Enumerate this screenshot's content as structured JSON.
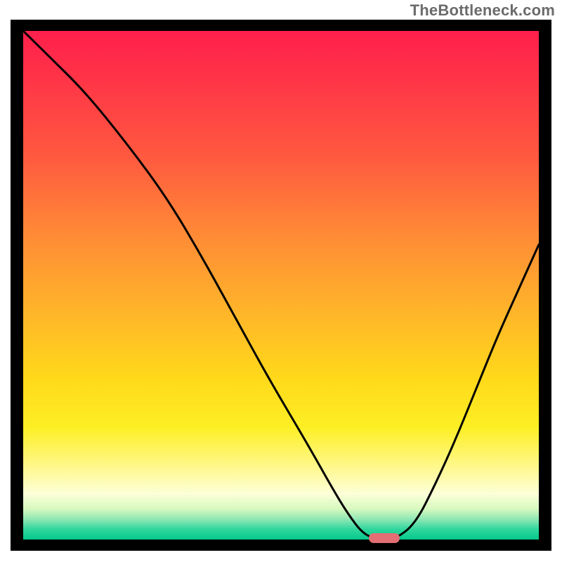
{
  "watermark": "TheBottleneck.com",
  "chart_data": {
    "type": "line",
    "title": "",
    "xlabel": "",
    "ylabel": "",
    "xlim": [
      0,
      100
    ],
    "ylim": [
      0,
      100
    ],
    "x": [
      0,
      5,
      12,
      20,
      28,
      35,
      42,
      48,
      55,
      60,
      63,
      66,
      69,
      72,
      76,
      80,
      84,
      88,
      92,
      96,
      100
    ],
    "values": [
      100,
      95,
      88,
      78,
      67,
      55,
      42,
      31,
      19,
      10,
      5,
      1,
      0,
      0,
      3,
      11,
      20,
      30,
      40,
      49,
      58
    ],
    "marker": {
      "x_start": 67,
      "x_end": 73,
      "y": 0
    },
    "gradient_stops": [
      {
        "pos": 0.0,
        "color": "#ff1f4b"
      },
      {
        "pos": 0.4,
        "color": "#ff8a36"
      },
      {
        "pos": 0.68,
        "color": "#ffd81a"
      },
      {
        "pos": 0.91,
        "color": "#fcffd8"
      },
      {
        "pos": 1.0,
        "color": "#05c98b"
      }
    ]
  }
}
